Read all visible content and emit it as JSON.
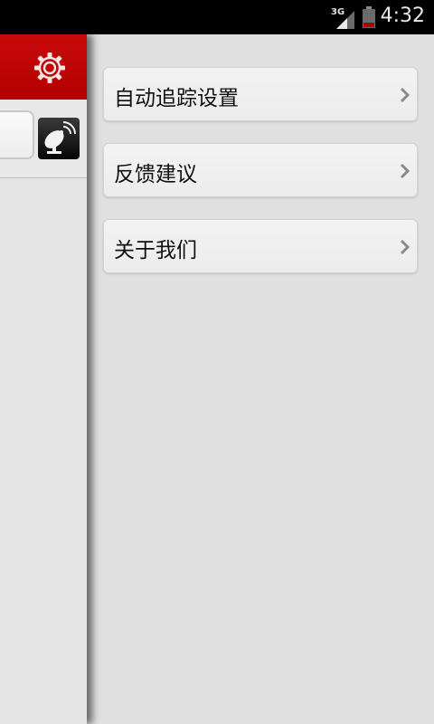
{
  "status_bar": {
    "network_label": "3G",
    "time": "4:32"
  },
  "menu": {
    "items": [
      {
        "label": "自动追踪设置"
      },
      {
        "label": "反馈建议"
      },
      {
        "label": "关于我们"
      }
    ]
  },
  "colors": {
    "header_red": "#c00000",
    "menu_background": "#e0e0e0",
    "item_background": "#efefef",
    "chevron": "#8a8a8a"
  },
  "icons": {
    "header": "gear-icon",
    "radar": "satellite-dish-icon",
    "menu_arrow": "chevron-right-icon"
  }
}
